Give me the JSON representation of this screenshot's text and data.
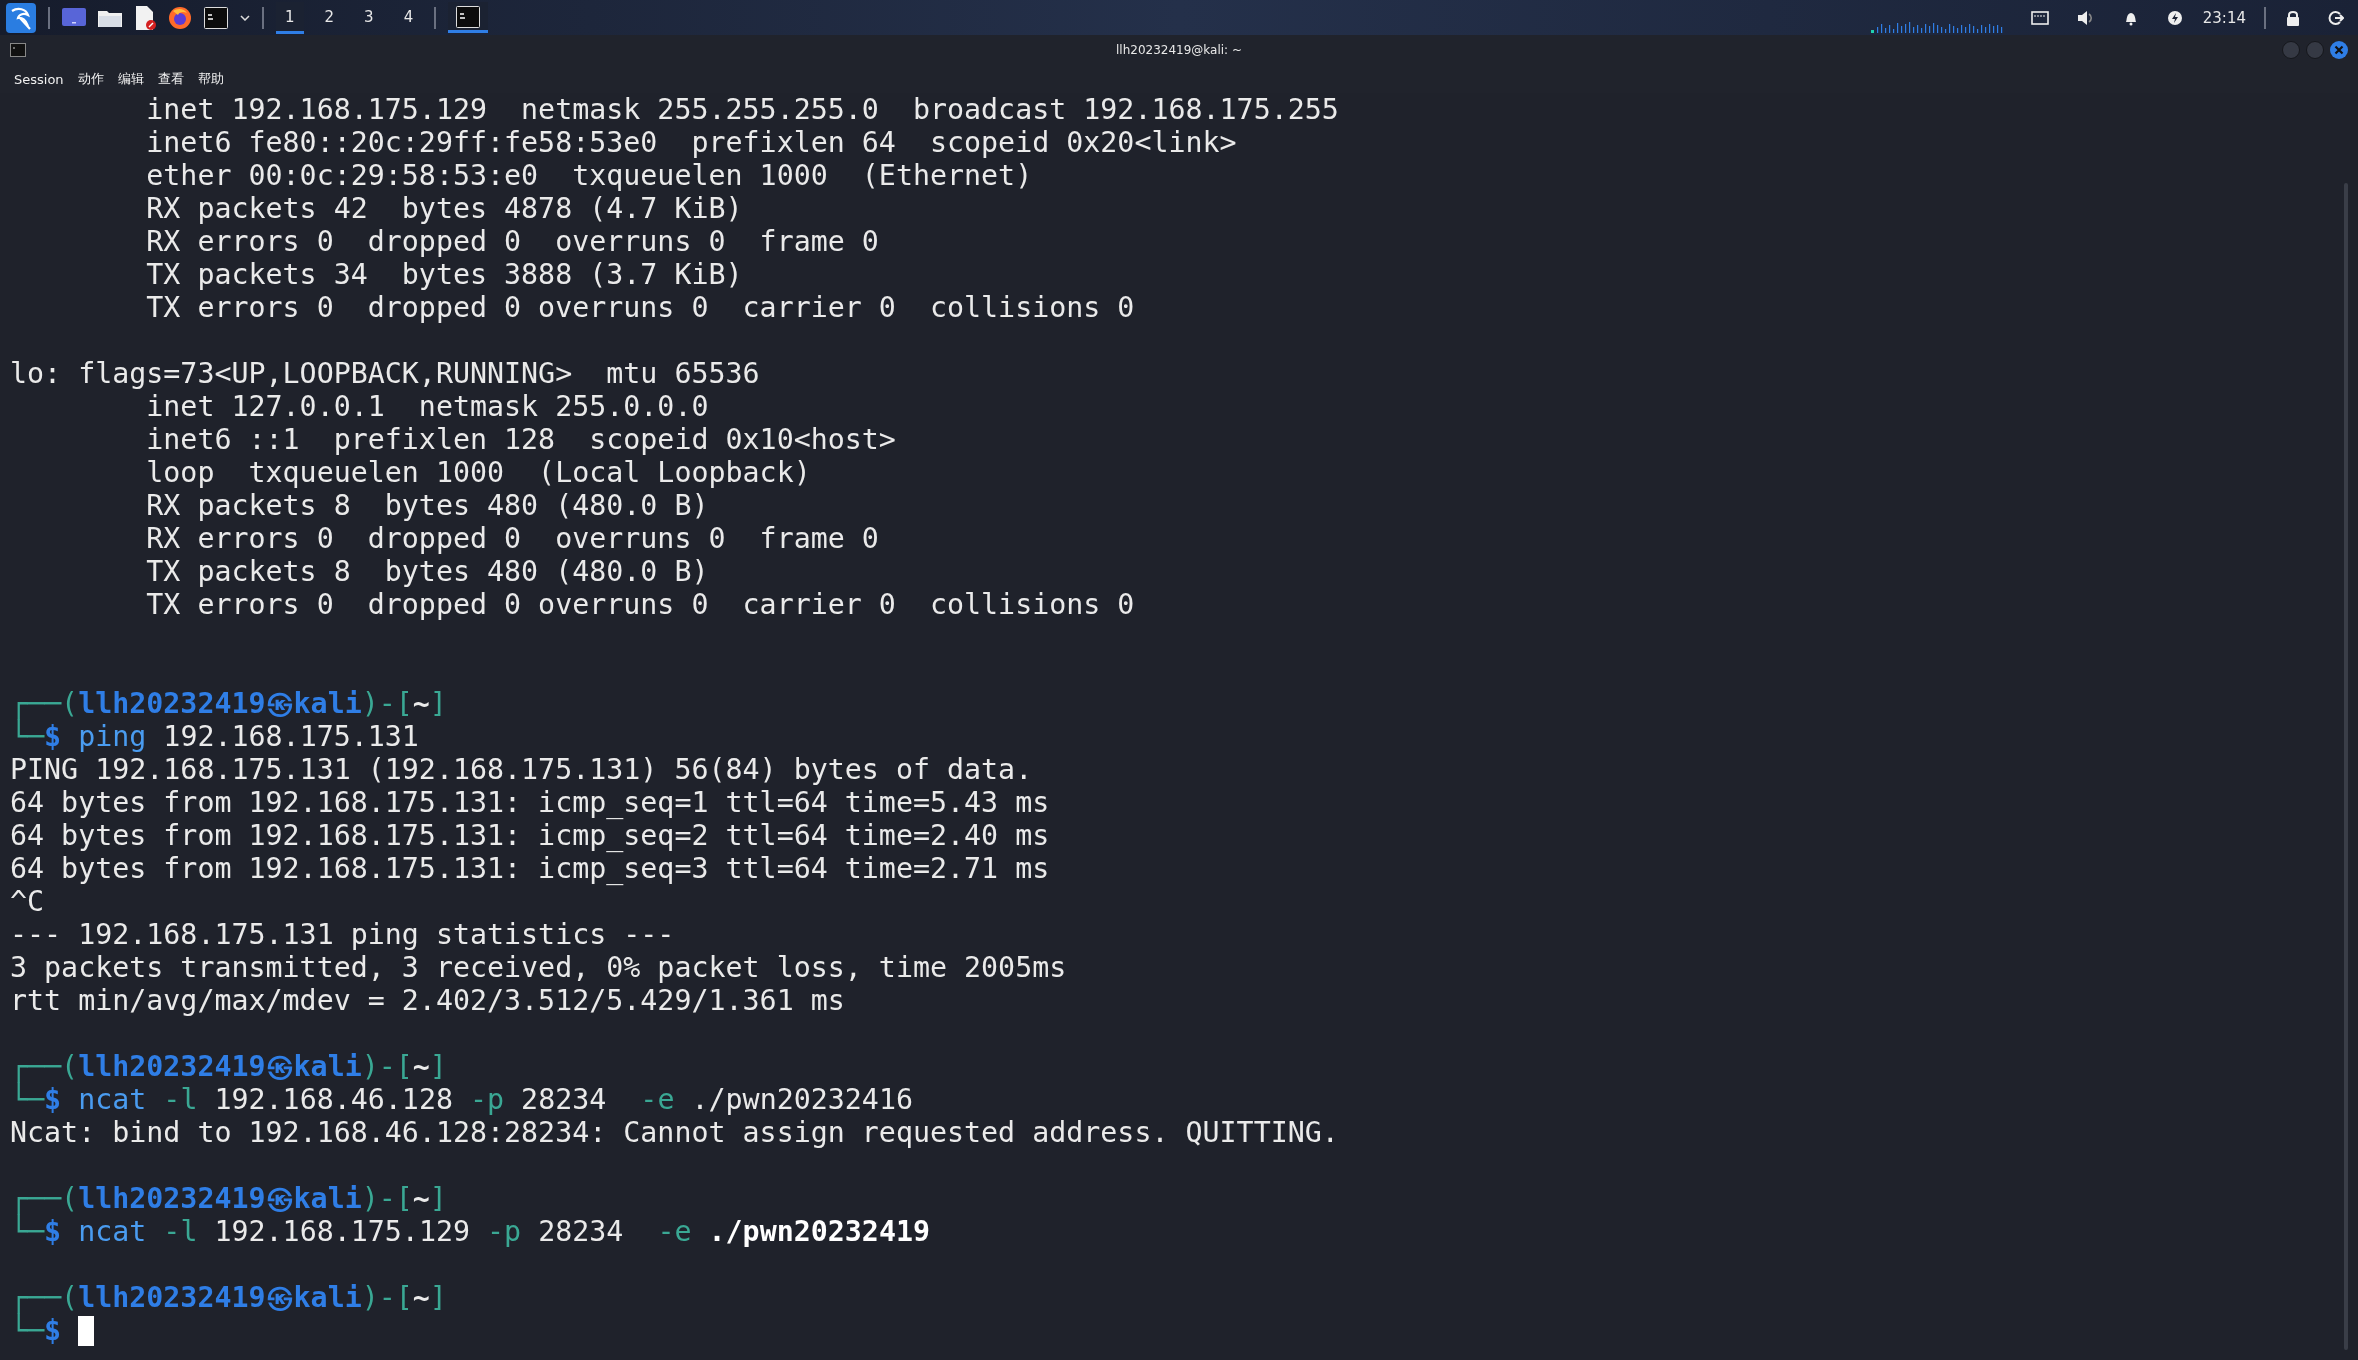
{
  "taskbar": {
    "workspaces": [
      {
        "label": "1",
        "selected": true
      },
      {
        "label": "2",
        "selected": false
      },
      {
        "label": "3",
        "selected": false
      },
      {
        "label": "4",
        "selected": false
      }
    ],
    "clock": "23:14"
  },
  "window": {
    "title": "llh20232419@kali: ~"
  },
  "menu": [
    "Session",
    "动作",
    "编辑",
    "查看",
    "帮助"
  ],
  "terminal": {
    "lines": [
      {
        "kind": "text",
        "text": "        inet 192.168.175.129  netmask 255.255.255.0  broadcast 192.168.175.255"
      },
      {
        "kind": "text",
        "text": "        inet6 fe80::20c:29ff:fe58:53e0  prefixlen 64  scopeid 0x20<link>"
      },
      {
        "kind": "text",
        "text": "        ether 00:0c:29:58:53:e0  txqueuelen 1000  (Ethernet)"
      },
      {
        "kind": "text",
        "text": "        RX packets 42  bytes 4878 (4.7 KiB)"
      },
      {
        "kind": "text",
        "text": "        RX errors 0  dropped 0  overruns 0  frame 0"
      },
      {
        "kind": "text",
        "text": "        TX packets 34  bytes 3888 (3.7 KiB)"
      },
      {
        "kind": "text",
        "text": "        TX errors 0  dropped 0 overruns 0  carrier 0  collisions 0"
      },
      {
        "kind": "blank"
      },
      {
        "kind": "text",
        "text": "lo: flags=73<UP,LOOPBACK,RUNNING>  mtu 65536"
      },
      {
        "kind": "text",
        "text": "        inet 127.0.0.1  netmask 255.0.0.0"
      },
      {
        "kind": "text",
        "text": "        inet6 ::1  prefixlen 128  scopeid 0x10<host>"
      },
      {
        "kind": "text",
        "text": "        loop  txqueuelen 1000  (Local Loopback)"
      },
      {
        "kind": "text",
        "text": "        RX packets 8  bytes 480 (480.0 B)"
      },
      {
        "kind": "text",
        "text": "        RX errors 0  dropped 0  overruns 0  frame 0"
      },
      {
        "kind": "text",
        "text": "        TX packets 8  bytes 480 (480.0 B)"
      },
      {
        "kind": "text",
        "text": "        TX errors 0  dropped 0 overruns 0  carrier 0  collisions 0"
      },
      {
        "kind": "blank"
      },
      {
        "kind": "blank"
      },
      {
        "kind": "prompt",
        "open": "┌──(",
        "user": "llh20232419㉿kali",
        "mid": ")-[",
        "dir": "~",
        "close": "]"
      },
      {
        "kind": "command",
        "prefix": "└─$",
        "cursor": false,
        "parts": [
          {
            "kind": "cmd",
            "text": " ping"
          },
          {
            "kind": "arg",
            "text": " 192.168.175.131"
          }
        ]
      },
      {
        "kind": "text",
        "text": "PING 192.168.175.131 (192.168.175.131) 56(84) bytes of data."
      },
      {
        "kind": "text",
        "text": "64 bytes from 192.168.175.131: icmp_seq=1 ttl=64 time=5.43 ms"
      },
      {
        "kind": "text",
        "text": "64 bytes from 192.168.175.131: icmp_seq=2 ttl=64 time=2.40 ms"
      },
      {
        "kind": "text",
        "text": "64 bytes from 192.168.175.131: icmp_seq=3 ttl=64 time=2.71 ms"
      },
      {
        "kind": "text",
        "text": "^C"
      },
      {
        "kind": "text",
        "text": "--- 192.168.175.131 ping statistics ---"
      },
      {
        "kind": "text",
        "text": "3 packets transmitted, 3 received, 0% packet loss, time 2005ms"
      },
      {
        "kind": "text",
        "text": "rtt min/avg/max/mdev = 2.402/3.512/5.429/1.361 ms"
      },
      {
        "kind": "blank"
      },
      {
        "kind": "prompt",
        "open": "┌──(",
        "user": "llh20232419㉿kali",
        "mid": ")-[",
        "dir": "~",
        "close": "]"
      },
      {
        "kind": "command",
        "prefix": "└─$",
        "cursor": false,
        "parts": [
          {
            "kind": "cmd",
            "text": " ncat"
          },
          {
            "kind": "flag",
            "text": " -l"
          },
          {
            "kind": "arg",
            "text": " 192.168.46.128"
          },
          {
            "kind": "flag",
            "text": " -p"
          },
          {
            "kind": "arg",
            "text": " 28234"
          },
          {
            "kind": "flag",
            "text": "  -e"
          },
          {
            "kind": "arg",
            "text": " ./pwn20232416"
          }
        ]
      },
      {
        "kind": "text",
        "text": "Ncat: bind to 192.168.46.128:28234: Cannot assign requested address. QUITTING."
      },
      {
        "kind": "blank"
      },
      {
        "kind": "prompt",
        "open": "┌──(",
        "user": "llh20232419㉿kali",
        "mid": ")-[",
        "dir": "~",
        "close": "]"
      },
      {
        "kind": "command",
        "prefix": "└─$",
        "cursor": false,
        "parts": [
          {
            "kind": "cmd",
            "text": " ncat"
          },
          {
            "kind": "flag",
            "text": " -l"
          },
          {
            "kind": "arg",
            "text": " 192.168.175.129"
          },
          {
            "kind": "flag",
            "text": " -p"
          },
          {
            "kind": "arg",
            "text": " 28234"
          },
          {
            "kind": "flag",
            "text": "  -e"
          },
          {
            "kind": "bold",
            "text": " ./pwn20232419"
          }
        ]
      },
      {
        "kind": "blank"
      },
      {
        "kind": "prompt",
        "open": "┌──(",
        "user": "llh20232419㉿kali",
        "mid": ")-[",
        "dir": "~",
        "close": "]"
      },
      {
        "kind": "command",
        "prefix": "└─$",
        "cursor": true
      }
    ]
  }
}
